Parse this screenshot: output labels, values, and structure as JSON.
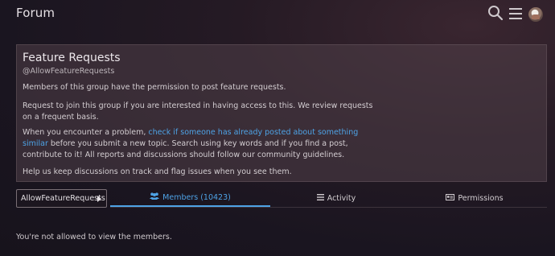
{
  "header": {
    "brand": "Forum",
    "search_icon": "search-icon",
    "menu_icon": "hamburger-menu-icon",
    "avatar_icon": "user-avatar"
  },
  "group": {
    "title": "Feature Requests",
    "handle": "@AllowFeatureRequests",
    "p1": "Members of this group have the permission to post feature requests.",
    "p2": "Request to join this group if you are interested in having access to this. We review requests on a frequent basis.",
    "p3_before": "When you encounter a problem, ",
    "p3_link": "check if someone has already posted about something similar",
    "p3_after": " before you submit a new topic. Search using key words and if you find a post, contribute to it! All reports and discussions should follow our community guidelines.",
    "p4": "Help us keep discussions on track and flag issues when you see them."
  },
  "tabs": {
    "group_dropdown": "AllowFeatureRequests",
    "members": "Members (10423)",
    "activity": "Activity",
    "permissions": "Permissions"
  },
  "message": "You're not allowed to view the members.",
  "colors": {
    "accent": "#4ea3e6"
  }
}
